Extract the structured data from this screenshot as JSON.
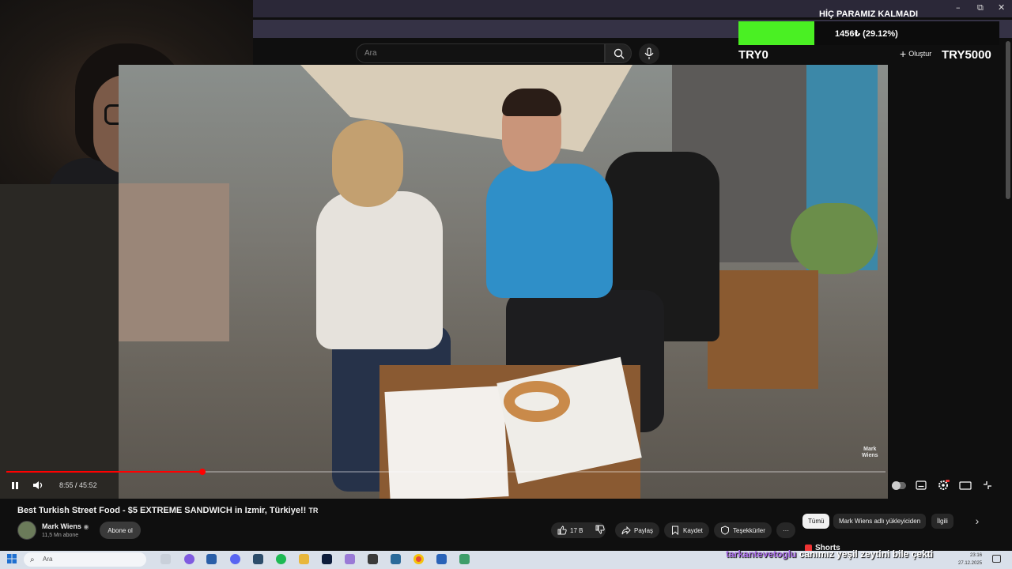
{
  "window": {
    "minimize": "–",
    "maximize": "⧉",
    "close": "✕"
  },
  "header": {
    "search_placeholder": "Ara",
    "create_label": "Oluştur"
  },
  "overlay": {
    "goal_title": "HİÇ PARAMIZ KALMADI",
    "amount": "1456₺ (29.12%)",
    "progress_fraction": 0.2912,
    "min_label": "TRY0",
    "max_label": "TRY5000",
    "bar_color": "#4af023"
  },
  "video": {
    "watermark": [
      "Mark",
      "Wiens"
    ],
    "current_time": "8:55",
    "duration": "45:52",
    "progress_fraction": 0.2233,
    "accent_color": "#ff0000"
  },
  "meta": {
    "title": "Best Turkish Street Food - $5 EXTREME SANDWICH in Izmir, Türkiye!!",
    "title_suffix": "TR",
    "channel_name": "Mark Wiens",
    "verified": "◉",
    "subscribers": "11,5 Mn abone",
    "subscribe_label": "Abone ol",
    "likes": "17 B",
    "share_label": "Paylaş",
    "save_label": "Kaydet",
    "thanks_label": "Teşekkürler",
    "more_label": "···"
  },
  "chips": {
    "all": "Tümü",
    "uploader": "Mark Wiens adlı yükleyiciden",
    "related": "İlgili",
    "next": "›"
  },
  "shorts": {
    "label": "Shorts"
  },
  "chat": {
    "username": "tarkantevetoglu",
    "message": "canımız yeşil zeytini bile çekti"
  },
  "taskbar": {
    "search_placeholder": "Ara",
    "time": "23:16",
    "date": "27.12.2025"
  }
}
